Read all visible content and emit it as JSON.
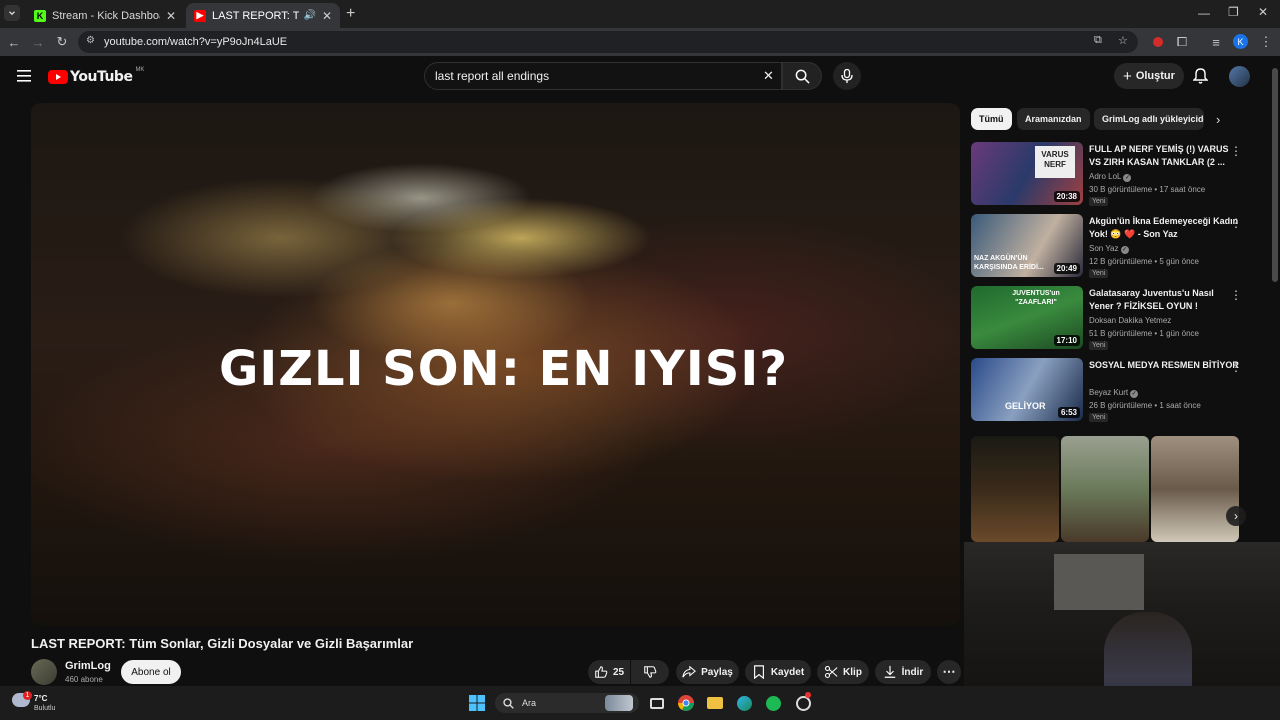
{
  "browser": {
    "tabs": [
      {
        "title": "Stream - Kick Dashboard",
        "active": false
      },
      {
        "title": "LAST REPORT: Tüm Sonlar,",
        "active": true
      }
    ],
    "url": "youtube.com/watch?v=yP9oJn4LaUE",
    "profile_initial": "K"
  },
  "youtube": {
    "logo": "YouTube",
    "logo_region": "MK",
    "search_value": "last report all endings",
    "create_label": "Oluştur",
    "video": {
      "overlay_text": "GIZLI SON: EN IYISI?",
      "title": "LAST REPORT: Tüm Sonlar, Gizli Dosyalar ve Gizli Başarımlar",
      "channel": "GrimLog",
      "subscribers": "460 abone",
      "subscribe_label": "Abone ol",
      "likes": "25",
      "share_label": "Paylaş",
      "save_label": "Kaydet",
      "clip_label": "Klip",
      "download_label": "İndir"
    },
    "chips": [
      "Tümü",
      "Aramanızdan",
      "GrimLog adlı yükleyicide"
    ],
    "recommendations": [
      {
        "title": "FULL AP NERF YEMİŞ (!) VARUS VS ZIRH KASAN TANKLAR (2 ...",
        "channel": "Adro LoL",
        "meta": "30 B görüntüleme • 17 saat önce",
        "badge": "Yeni",
        "duration": "20:38",
        "thumb_text": "VARUS NERF"
      },
      {
        "title": "Akgün'ün İkna Edemeyeceği Kadın Yok! 😳 ❤️ - Son Yaz",
        "channel": "Son Yaz",
        "meta": "12 B görüntüleme • 5 gün önce",
        "badge": "Yeni",
        "duration": "20:49",
        "thumb_text": "NAZ AKGÜN'ÜN KARŞISINDA ERİDİ..."
      },
      {
        "title": "Galatasaray Juventus'u Nasıl Yener ? FİZİKSEL OYUN !",
        "channel": "Doksan Dakika Yetmez",
        "meta": "51 B görüntüleme • 1 gün önce",
        "badge": "Yeni",
        "duration": "17:10",
        "thumb_text": "JUVENTUS'un \"ZAAFLARI\""
      },
      {
        "title": "SOSYAL MEDYA RESMEN BİTİYOR",
        "channel": "Beyaz Kurt",
        "meta": "26 B görüntüleme • 1 saat önce",
        "badge": "Yeni",
        "duration": "6:53",
        "thumb_text": "GELİYOR"
      }
    ]
  },
  "taskbar": {
    "weather_temp": "7°C",
    "weather_desc": "Bulutlu",
    "weather_badge": "1",
    "search_label": "Ara"
  }
}
